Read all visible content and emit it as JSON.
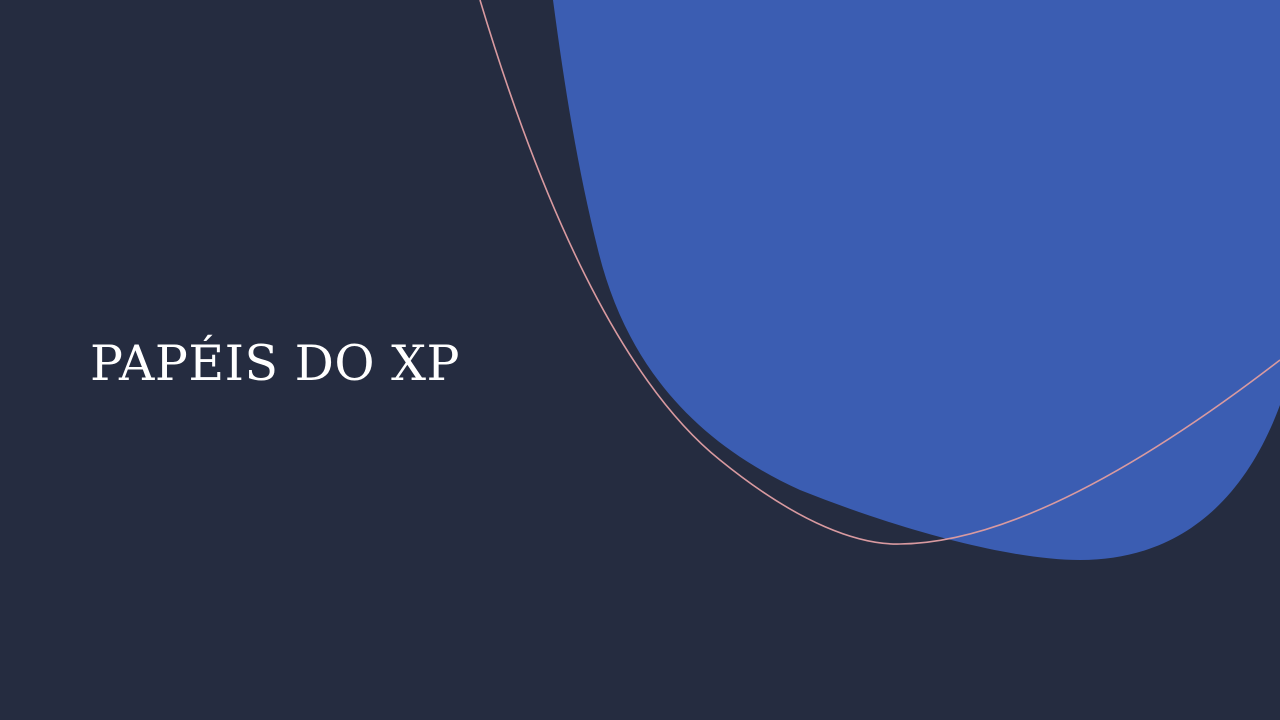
{
  "slide": {
    "title": "PAPÉIS DO XP"
  },
  "colors": {
    "background": "#252c40",
    "blob": "#3b5db2",
    "line": "#d99aa0",
    "title_text": "#ffffff"
  }
}
